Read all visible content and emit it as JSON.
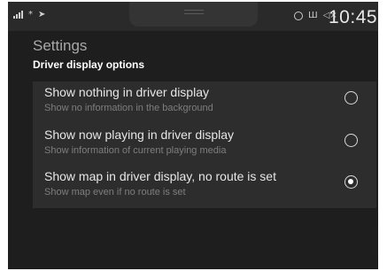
{
  "status": {
    "left_glyphs": [
      "*",
      "➤"
    ],
    "icons": [
      "radio-icon",
      "list-icon",
      "volume-icon"
    ],
    "time": "10:45"
  },
  "header": {
    "title": "Settings",
    "subtitle": "Driver display options"
  },
  "options": [
    {
      "title": "Show nothing in driver display",
      "subtitle": "Show no information in the background",
      "selected": false
    },
    {
      "title": "Show now playing in driver display",
      "subtitle": "Show information of current playing media",
      "selected": false
    },
    {
      "title": "Show map in driver display, no route is set",
      "subtitle": "Show map even if no route is set",
      "selected": true
    }
  ],
  "doc_id": "G053249",
  "colors": {
    "screen": "#1e1e1e",
    "panel": "#2d2d2d",
    "text": "#e6e6e6",
    "subtext": "#7e7e7e"
  }
}
